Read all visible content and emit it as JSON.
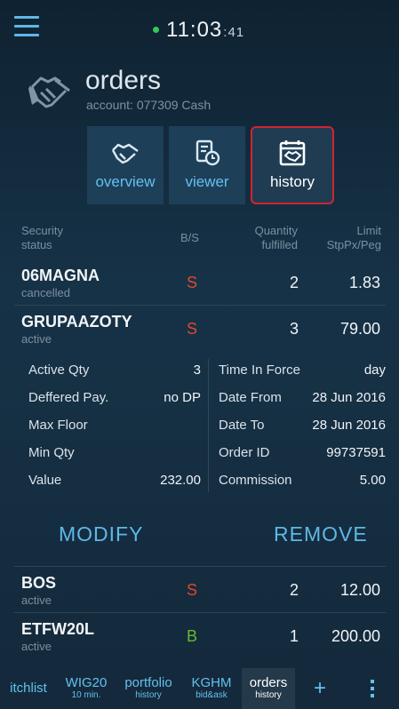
{
  "clock": {
    "time": "11:03",
    "seconds": ":41"
  },
  "header": {
    "title": "orders",
    "account": "account: 077309 Cash"
  },
  "nav": [
    {
      "label": "overview",
      "icon": "handshake-icon"
    },
    {
      "label": "viewer",
      "icon": "document-clock-icon"
    },
    {
      "label": "history",
      "icon": "calendar-handshake-icon"
    }
  ],
  "table_header": {
    "security": "Security",
    "status": "status",
    "bs": "B/S",
    "quantity": "Quantity",
    "fulfilled": "fulfilled",
    "limit": "Limit",
    "stp": "StpPx/Peg"
  },
  "orders": [
    {
      "symbol": "06MAGNA",
      "status": "cancelled",
      "side": "S",
      "quantity": "2",
      "limit": "1.83"
    },
    {
      "symbol": "GRUPAAZOTY",
      "status": "active",
      "side": "S",
      "quantity": "3",
      "limit": "79.00"
    },
    {
      "symbol": "BOS",
      "status": "active",
      "side": "S",
      "quantity": "2",
      "limit": "12.00"
    },
    {
      "symbol": "ETFW20L",
      "status": "active",
      "side": "B",
      "quantity": "1",
      "limit": "200.00"
    }
  ],
  "details": {
    "left": [
      {
        "k": "Active Qty",
        "v": "3"
      },
      {
        "k": "Deffered Pay.",
        "v": "no DP"
      },
      {
        "k": "Max Floor",
        "v": ""
      },
      {
        "k": "Min Qty",
        "v": ""
      },
      {
        "k": "Value",
        "v": "232.00"
      }
    ],
    "right": [
      {
        "k": "Time In Force",
        "v": "day"
      },
      {
        "k": "Date From",
        "v": "28 Jun 2016"
      },
      {
        "k": "Date To",
        "v": "28 Jun 2016"
      },
      {
        "k": "Order ID",
        "v": "99737591"
      },
      {
        "k": "Commission",
        "v": "5.00"
      }
    ]
  },
  "actions": {
    "modify": "MODIFY",
    "remove": "REMOVE"
  },
  "tabs": [
    {
      "t1": "itchlist",
      "t2": ""
    },
    {
      "t1": "WIG20",
      "t2": "10 min."
    },
    {
      "t1": "portfolio",
      "t2": "history"
    },
    {
      "t1": "KGHM",
      "t2": "bid&ask"
    },
    {
      "t1": "orders",
      "t2": "history"
    },
    {
      "t1": "+",
      "t2": ""
    }
  ],
  "colors": {
    "sell": "#e0482e",
    "buy": "#69b830",
    "accent": "#63c0ee",
    "active_border": "#d2242f"
  }
}
